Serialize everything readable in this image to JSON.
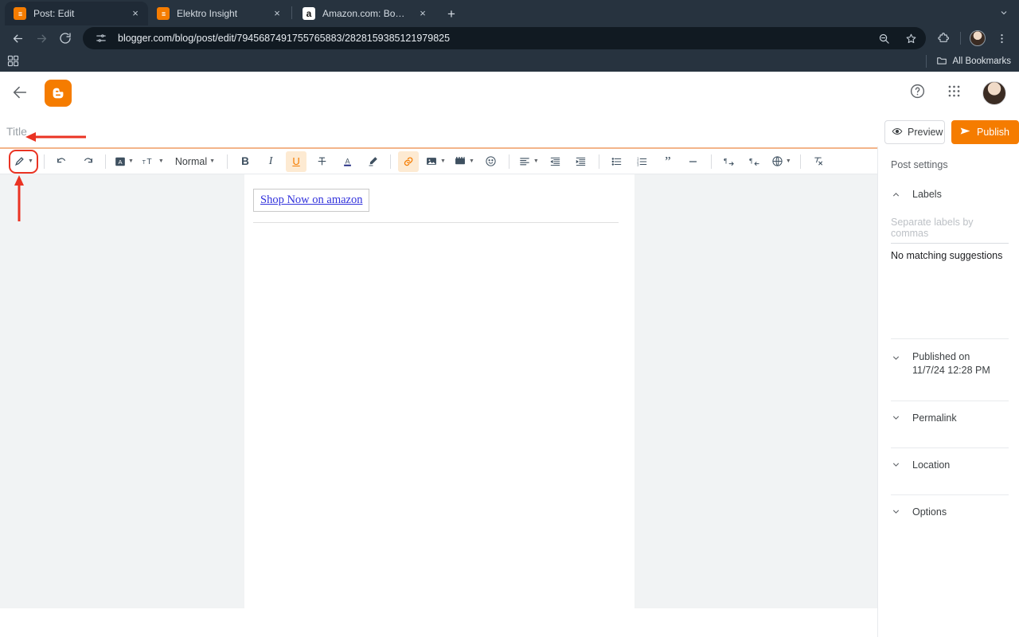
{
  "browser": {
    "tabs": [
      {
        "title": "Post: Edit",
        "favicon": "blogger-icon",
        "active": true,
        "close": "×"
      },
      {
        "title": "Elektro Insight",
        "favicon": "blogger-icon",
        "active": false,
        "close": "×"
      },
      {
        "title": "Amazon.com: Boost Mobile | A",
        "favicon": "amazon-icon",
        "active": false,
        "close": "×"
      }
    ],
    "new_tab_label": "+",
    "tab_list_chevron": "⌄",
    "url": "blogger.com/blog/post/edit/7945687491755765883/2828159385121979825",
    "nav": {
      "back": "back-icon",
      "forward": "forward-icon",
      "reload": "reload-icon"
    },
    "omnibox_icons": {
      "site_settings": "tune-icon",
      "zoom_out": "zoom-out-icon",
      "bookmark": "star-icon"
    },
    "toolbar_icons": {
      "extensions": "puzzle-icon",
      "profile": "avatar-icon",
      "menu": "three-dot-menu-icon"
    },
    "bookmarks_bar": {
      "apps_icon": "apps-grid-icon",
      "all_bookmarks_label": "All Bookmarks",
      "folder_icon": "folder-icon"
    }
  },
  "blogger_header": {
    "back_icon": "back-arrow-icon",
    "logo": "blogger-logo-icon",
    "help_icon": "help-circle-icon",
    "apps_icon": "google-apps-icon",
    "avatar": "user-avatar"
  },
  "title_row": {
    "placeholder": "Title",
    "value": "",
    "preview_label": "Preview",
    "preview_icon": "eye-icon",
    "preview_caret": "▾",
    "publish_label": "Publish",
    "publish_icon": "send-icon",
    "accent_color": "#f57c00"
  },
  "format_toolbar": {
    "items": [
      {
        "name": "pen-compose-icon",
        "label": "",
        "caret": true,
        "highlight": "red-box"
      },
      {
        "name": "undo-icon",
        "label": "",
        "caret": false
      },
      {
        "name": "redo-icon",
        "label": "",
        "caret": false
      },
      {
        "name": "font-family-icon",
        "label": "",
        "caret": true
      },
      {
        "name": "font-size-icon",
        "label": "",
        "caret": true
      },
      {
        "name": "paragraph-style-select",
        "label": "Normal",
        "caret": true
      },
      {
        "name": "bold-icon",
        "label": "B",
        "caret": false
      },
      {
        "name": "italic-icon",
        "label": "I",
        "caret": false
      },
      {
        "name": "underline-icon",
        "label": "U",
        "caret": false,
        "active": true
      },
      {
        "name": "strikethrough-icon",
        "label": "",
        "caret": false
      },
      {
        "name": "text-color-icon",
        "label": "A",
        "caret": false
      },
      {
        "name": "highlight-color-icon",
        "label": "",
        "caret": false
      },
      {
        "name": "link-icon",
        "label": "",
        "caret": false,
        "active": true
      },
      {
        "name": "insert-image-icon",
        "label": "",
        "caret": true
      },
      {
        "name": "insert-video-icon",
        "label": "",
        "caret": true
      },
      {
        "name": "emoji-icon",
        "label": "",
        "caret": false
      },
      {
        "name": "align-icon",
        "label": "",
        "caret": true
      },
      {
        "name": "indent-decrease-icon",
        "label": "",
        "caret": false
      },
      {
        "name": "indent-increase-icon",
        "label": "",
        "caret": false
      },
      {
        "name": "bulleted-list-icon",
        "label": "",
        "caret": false
      },
      {
        "name": "numbered-list-icon",
        "label": "",
        "caret": false
      },
      {
        "name": "blockquote-icon",
        "label": "",
        "caret": false
      },
      {
        "name": "insert-jump-break-icon",
        "label": "",
        "caret": false
      },
      {
        "name": "text-ltr-icon",
        "label": "",
        "caret": false
      },
      {
        "name": "text-rtl-icon",
        "label": "",
        "caret": false
      },
      {
        "name": "translate-icon",
        "label": "",
        "caret": true
      },
      {
        "name": "clear-formatting-icon",
        "label": "",
        "caret": false
      }
    ]
  },
  "editor": {
    "link_text": "Shop Now on amazon"
  },
  "sidebar": {
    "title": "Post settings",
    "labels_section": {
      "label": "Labels",
      "expanded": true,
      "chevron": "chevron-up",
      "input_placeholder": "Separate labels by commas",
      "input_value": "",
      "suggestion_text": "No matching suggestions"
    },
    "sections": [
      {
        "label": "Published on",
        "sublabel": "11/7/24 12:28 PM",
        "chevron": "chevron-down"
      },
      {
        "label": "Permalink",
        "sublabel": "",
        "chevron": "chevron-down"
      },
      {
        "label": "Location",
        "sublabel": "",
        "chevron": "chevron-down"
      },
      {
        "label": "Options",
        "sublabel": "",
        "chevron": "chevron-down"
      }
    ]
  },
  "annotations": {
    "color": "#ea3323",
    "arrow_to_title": "horizontal-arrow-pointing-left",
    "arrow_to_pen": "vertical-arrow-pointing-up"
  }
}
